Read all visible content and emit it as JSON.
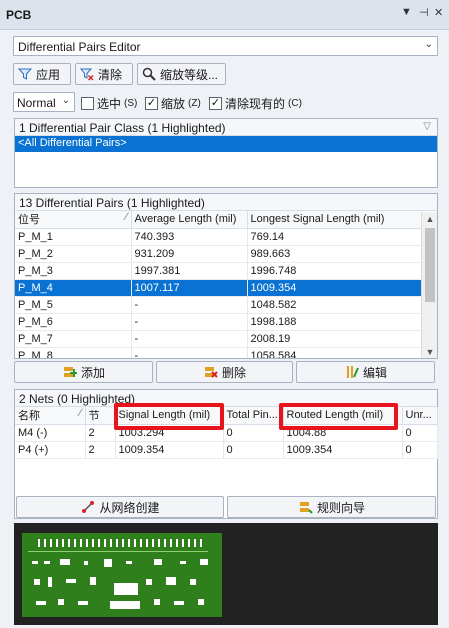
{
  "panel_title": "PCB",
  "title_controls": {
    "menu": "▼",
    "pin": "⊣",
    "close": "✕"
  },
  "editor_select": {
    "value": "Differential Pairs Editor"
  },
  "toolbar": {
    "apply": "应用",
    "clear": "清除",
    "zoom_level": "缩放等级..."
  },
  "mode_select": {
    "value": "Normal"
  },
  "checks": [
    {
      "label": "选中",
      "shortcut": "(S)",
      "checked": false
    },
    {
      "label": "缩放",
      "shortcut": "(Z)",
      "checked": true
    },
    {
      "label": "清除现有的",
      "shortcut": "(C)",
      "checked": true
    }
  ],
  "classes": {
    "header": "1 Differential Pair Class (1 Highlighted)",
    "items": [
      "<All Differential Pairs>"
    ]
  },
  "pairs": {
    "header": "13 Differential Pairs (1 Highlighted)",
    "columns": [
      "位号",
      "Average Length (mil)",
      "Longest Signal Length (mil)"
    ],
    "rows": [
      [
        "P_M_1",
        "740.393",
        "769.14"
      ],
      [
        "P_M_2",
        "931.209",
        "989.663"
      ],
      [
        "P_M_3",
        "1997.381",
        "1996.748"
      ],
      [
        "P_M_4",
        "1007.117",
        "1009.354"
      ],
      [
        "P_M_5",
        "-",
        "1048.582"
      ],
      [
        "P_M_6",
        "-",
        "1998.188"
      ],
      [
        "P_M_7",
        "-",
        "2008.19"
      ],
      [
        "P_M_8",
        "-",
        "1058.584"
      ]
    ],
    "selected_row": "P_M_4"
  },
  "pair_buttons": {
    "add": "添加",
    "delete": "删除",
    "edit": "编辑"
  },
  "nets": {
    "header": "2 Nets (0 Highlighted)",
    "columns": [
      "名称",
      "节",
      "Signal Length (mil)",
      "Total Pin...",
      "Routed Length (mil)",
      "Unr..."
    ],
    "rows": [
      [
        "M4 (-)",
        "2",
        "1003.294",
        "0",
        "1004.88",
        "0"
      ],
      [
        "P4 (+)",
        "2",
        "1009.354",
        "0",
        "1009.354",
        "0"
      ]
    ]
  },
  "net_buttons": {
    "create_from_nets": "从网络创建",
    "rules_wizard": "规则向导"
  },
  "colors": {
    "highlight_box": "#e8141b",
    "selection": "#0a72d2",
    "pcb_green": "#2f7f1c"
  }
}
